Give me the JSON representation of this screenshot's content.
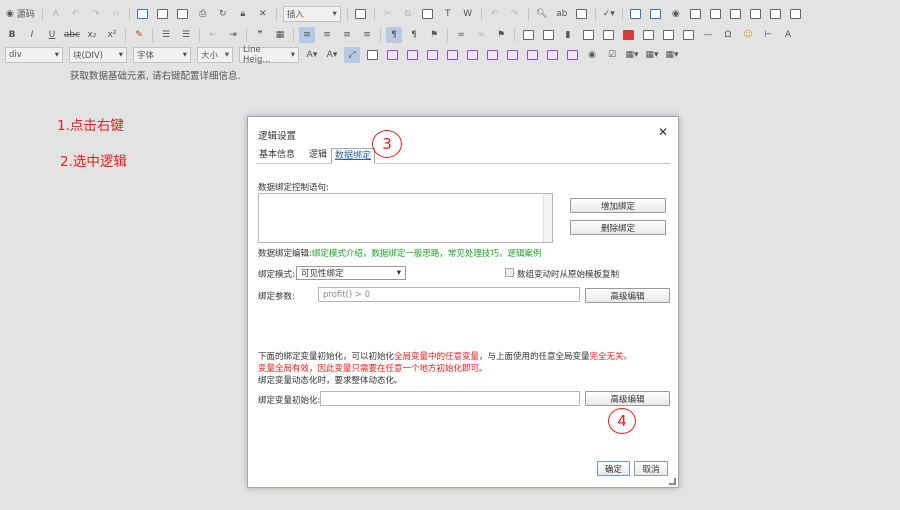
{
  "toolbar": {
    "source_label": "源码",
    "insert_select": "插入",
    "block_select": "div",
    "format_select": "块(DIV)",
    "font_select": "字体",
    "size_select": "大小",
    "line_height_select": "Line Heig..."
  },
  "hint": "获取数据基础元素, 请右键配置详细信息.",
  "annotations": {
    "step1": "1.点击右键",
    "step2": "2.选中逻辑",
    "step3": "3",
    "step4": "4"
  },
  "dialog": {
    "title": "逻辑设置",
    "tabs": [
      "基本信息",
      "逻辑",
      "数据绑定"
    ],
    "control_label": "数据绑定控制语句:",
    "add_binding": "增加绑定",
    "delete_binding": "删除绑定",
    "edit_prefix": "数据绑定编辑:",
    "edit_links": "绑定模式介绍，数据绑定一般思路，常见处理技巧，逻辑案例",
    "mode_label": "绑定模式:",
    "mode_value": "可见性绑定",
    "copy_label": "数组变动时从原始模板复制",
    "param_label": "绑定参数:",
    "param_placeholder": "profit() > 0",
    "advanced": "高级编辑",
    "note1_a": "下面的绑定变量初始化，可以初始化",
    "note1_b": "全局变量中的任意变量",
    "note1_c": "，与上面使用的任意全局变量",
    "note1_d": "完全无关。",
    "note2": "变量全局有效，因此变量只需要在任意一个地方初始化即可。",
    "note3": "绑定变量动态化时，要求整体动态化。",
    "init_label": "绑定变量初始化:",
    "init_value": "",
    "advanced2": "高级编辑",
    "ok": "确定",
    "cancel": "取消"
  }
}
